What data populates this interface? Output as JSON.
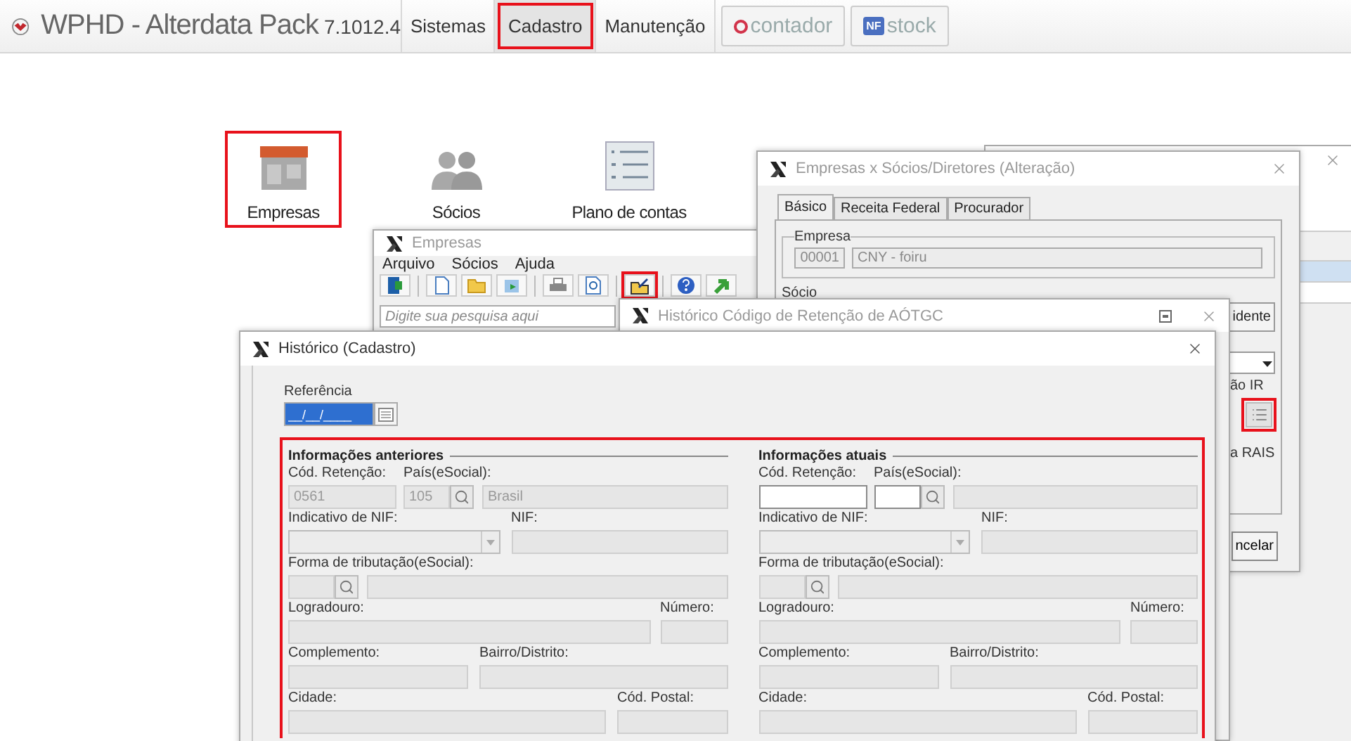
{
  "app": {
    "name": "WPHD",
    "subtitle": "- Alterdata Pack",
    "version": "7.1012.4"
  },
  "menu": [
    {
      "label": "Sistemas",
      "selected": false,
      "highlighted": false
    },
    {
      "label": "Cadastro",
      "selected": true,
      "highlighted": true
    },
    {
      "label": "Manutenção",
      "selected": false,
      "highlighted": false
    }
  ],
  "brands": [
    {
      "kind": "contador",
      "label": "contador"
    },
    {
      "kind": "stock",
      "badge": "NF",
      "label": "stock"
    }
  ],
  "launcher": [
    {
      "kind": "building",
      "label": "Empresas",
      "highlighted": true
    },
    {
      "kind": "people",
      "label": "Sócios",
      "highlighted": false
    },
    {
      "kind": "list",
      "label": "Plano de contas",
      "highlighted": false
    }
  ],
  "empresas_window": {
    "title": "Empresas",
    "menu": [
      "Arquivo",
      "Sócios",
      "Ajuda"
    ],
    "toolbar_groups": [
      {
        "buttons": [
          {
            "kind": "exit",
            "highlighted": false
          }
        ]
      },
      {
        "buttons": [
          {
            "kind": "new",
            "highlighted": false
          },
          {
            "kind": "open",
            "highlighted": false
          },
          {
            "kind": "export",
            "highlighted": false
          }
        ]
      },
      {
        "buttons": [
          {
            "kind": "print",
            "highlighted": false
          },
          {
            "kind": "preview",
            "highlighted": false
          }
        ]
      },
      {
        "buttons": [
          {
            "kind": "history",
            "highlighted": true
          }
        ]
      },
      {
        "buttons": [
          {
            "kind": "help",
            "highlighted": false
          },
          {
            "kind": "forward",
            "highlighted": false
          }
        ]
      }
    ],
    "search": {
      "placeholder": "Digite sua pesquisa aqui"
    }
  },
  "socios_window": {
    "title": "Empresas x Sócios/Diretores (Alteração)",
    "tabs": [
      {
        "label": "Básico",
        "selected": true
      },
      {
        "label": "Receita Federal",
        "selected": false
      },
      {
        "label": "Procurador",
        "selected": false
      }
    ],
    "empresa": {
      "legend": "Empresa",
      "code": "00001",
      "name": "CNY - foiru"
    },
    "socio_label": "Sócio",
    "side_button": "idente",
    "ir_label": "ão IR",
    "list_highlighted": true,
    "rais_label": "a RAIS",
    "cancel_button": "ncelar"
  },
  "retencao_window": {
    "title": "Histórico Código de Retenção de AÓTGC"
  },
  "historico_window": {
    "title": "Histórico (Cadastro)",
    "referencia": {
      "label": "Referência",
      "value": "__/__/____",
      "selected": true
    },
    "highlighted": true,
    "sections": [
      {
        "title": "Informações anteriores",
        "fields": [
          {
            "kind": "text",
            "label": "Cód. Retenção:",
            "value": "0561",
            "disabled": true
          },
          {
            "kind": "lookup",
            "label": "País(eSocial):",
            "code": "105",
            "name": "Brasil",
            "disabled": true
          },
          {
            "kind": "select",
            "label": "Indicativo de NIF:",
            "disabled": true
          },
          {
            "kind": "text",
            "label": "NIF:",
            "disabled": true
          },
          {
            "kind": "lookup",
            "label": "Forma de tributação(eSocial):",
            "disabled": true
          },
          {
            "kind": "text",
            "label": "Logradouro:",
            "disabled": true
          },
          {
            "kind": "text",
            "label": "Número:",
            "disabled": true
          },
          {
            "kind": "text",
            "label": "Complemento:",
            "disabled": true
          },
          {
            "kind": "text",
            "label": "Bairro/Distrito:",
            "disabled": true
          },
          {
            "kind": "text",
            "label": "Cidade:",
            "disabled": true
          },
          {
            "kind": "text",
            "label": "Cód. Postal:",
            "disabled": true
          }
        ]
      },
      {
        "title": "Informações atuais",
        "fields": [
          {
            "kind": "text",
            "label": "Cód. Retenção:",
            "disabled": false
          },
          {
            "kind": "lookup",
            "label": "País(eSocial):",
            "disabled": false
          },
          {
            "kind": "select",
            "label": "Indicativo de NIF:",
            "disabled": true
          },
          {
            "kind": "text",
            "label": "NIF:",
            "disabled": true
          },
          {
            "kind": "lookup",
            "label": "Forma de tributação(eSocial):",
            "disabled": true
          },
          {
            "kind": "text",
            "label": "Logradouro:",
            "disabled": true
          },
          {
            "kind": "text",
            "label": "Número:",
            "disabled": true
          },
          {
            "kind": "text",
            "label": "Complemento:",
            "disabled": true
          },
          {
            "kind": "text",
            "label": "Bairro/Distrito:",
            "disabled": true
          },
          {
            "kind": "text",
            "label": "Cidade:",
            "disabled": true
          },
          {
            "kind": "text",
            "label": "Cód. Postal:",
            "disabled": true
          }
        ]
      }
    ]
  }
}
